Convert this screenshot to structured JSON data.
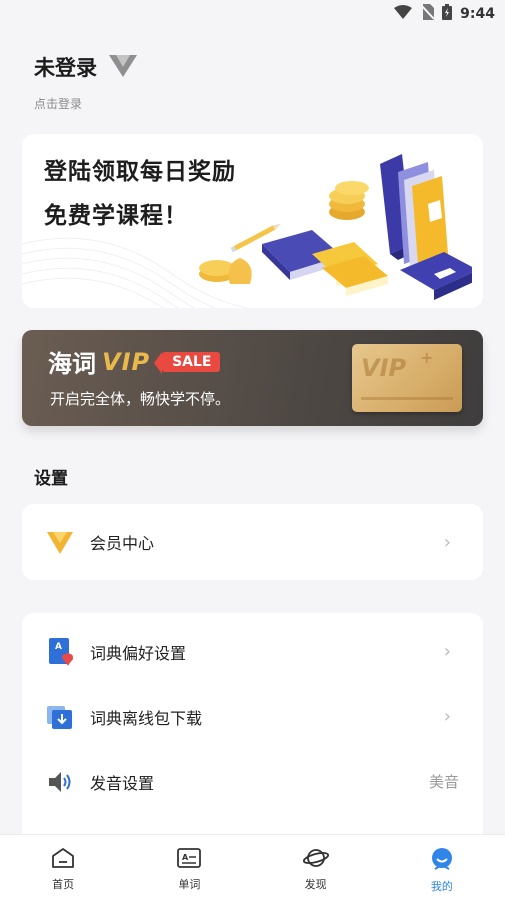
{
  "status_bar": {
    "time": "9:44"
  },
  "user": {
    "name": "未登录",
    "login_hint": "点击登录"
  },
  "promo": {
    "line1": "登陆领取每日奖励",
    "line2": "免费学课程！"
  },
  "vip_banner": {
    "title_cn": "海词",
    "title_vip": "VIP",
    "badge": "SALE",
    "subtitle": "开启完全体，畅快学不停。",
    "card_text": "VIP",
    "card_plus": "+"
  },
  "settings": {
    "title": "设置",
    "member_center": {
      "label": "会员中心"
    },
    "items": [
      {
        "label": "词典偏好设置"
      },
      {
        "label": "词典离线包下载"
      },
      {
        "label": "发音设置",
        "value": "美音"
      }
    ]
  },
  "bottom_nav": [
    {
      "label": "首页",
      "icon": "home-icon"
    },
    {
      "label": "单词",
      "icon": "word-card-icon"
    },
    {
      "label": "发现",
      "icon": "planet-icon"
    },
    {
      "label": "我的",
      "icon": "profile-icon",
      "active": true
    }
  ],
  "colors": {
    "accent": "#2f86e8",
    "vip_gold": "#e9b94c",
    "sale_red": "#e9493f"
  }
}
